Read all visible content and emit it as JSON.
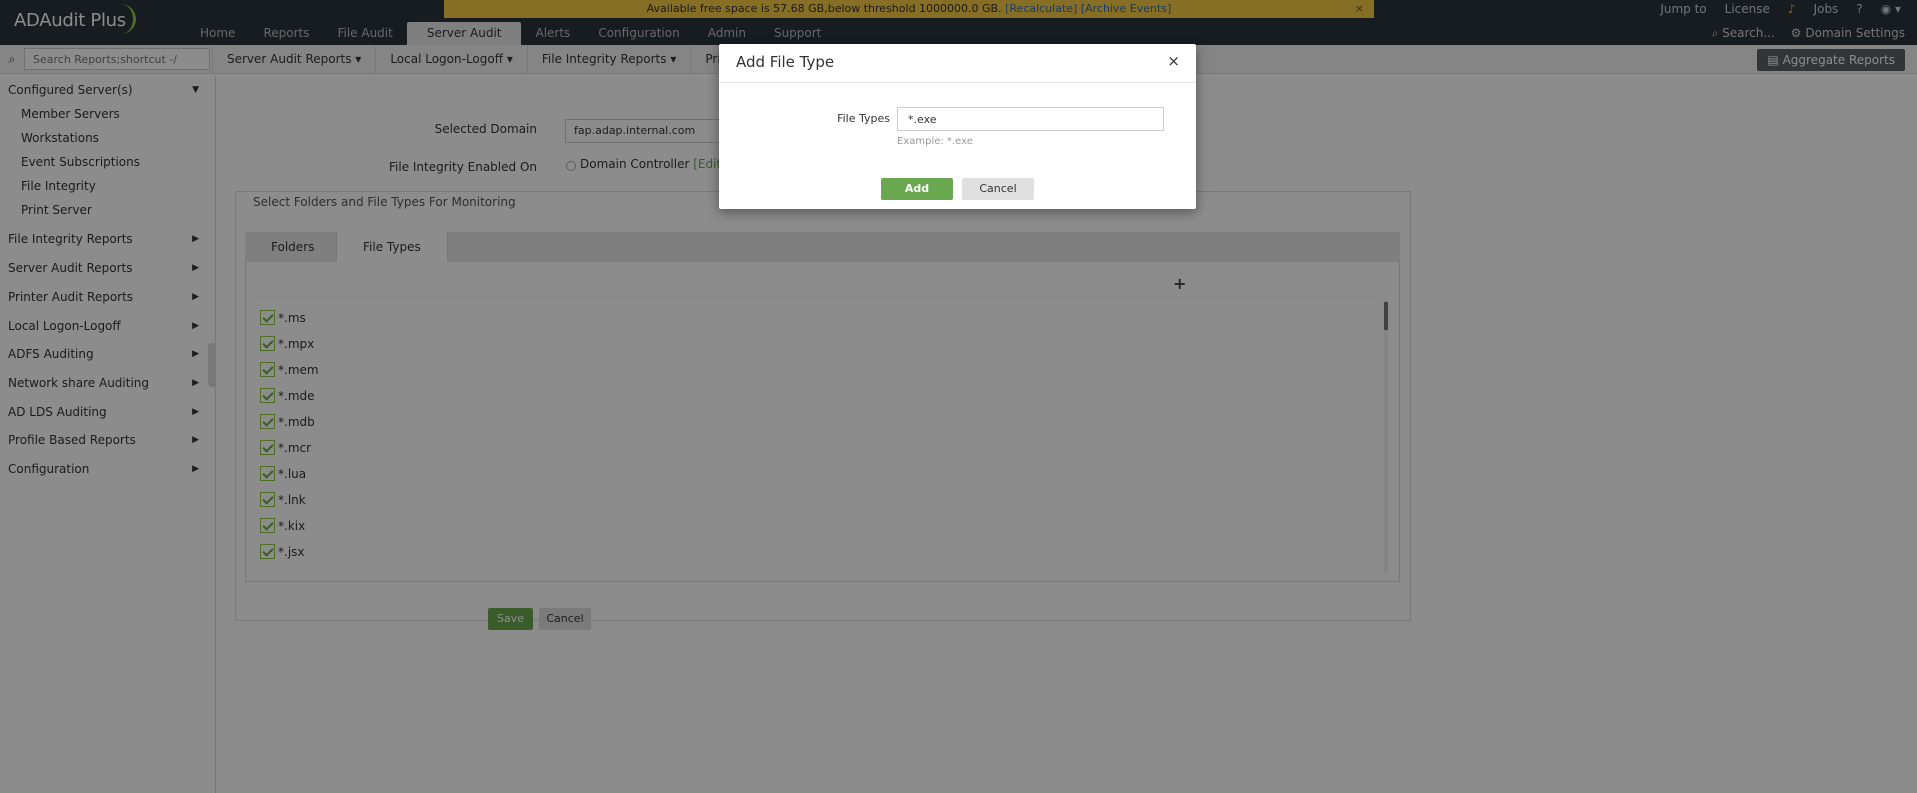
{
  "app": {
    "logo": "ADAudit Plus",
    "banner": {
      "text": "Available free space is 57.68 GB,below threshold 1000000.0 GB.",
      "recalculate": "[Recalculate]",
      "archive": "[Archive Events]",
      "close": "×"
    },
    "main_tabs": [
      "Home",
      "Reports",
      "File Audit",
      "Server Audit",
      "Alerts",
      "Configuration",
      "Admin",
      "Support"
    ],
    "active_tab": "Server Audit",
    "top_right": {
      "jump_to": "Jump to",
      "license": "License",
      "jobs": "Jobs",
      "help": "?",
      "search": "Search...",
      "domain_settings": "Domain Settings"
    }
  },
  "subbar": {
    "search_placeholder": "Search Reports;shortcut -/",
    "menus": [
      "Server Audit Reports ▾",
      "Local Logon-Logoff ▾",
      "File Integrity Reports ▾",
      "Printer Audit R"
    ],
    "aggregate": "Aggregate Reports"
  },
  "sidebar": {
    "configured": "Configured Server(s)",
    "sub_items": [
      "Member Servers",
      "Workstations",
      "Event Subscriptions",
      "File Integrity",
      "Print Server"
    ],
    "sections": [
      "File Integrity Reports",
      "Server Audit Reports",
      "Printer Audit Reports",
      "Local Logon-Logoff",
      "ADFS Auditing",
      "Network share Auditing",
      "AD LDS Auditing",
      "Profile Based Reports",
      "Configuration"
    ]
  },
  "form": {
    "selected_domain_label": "Selected Domain",
    "selected_domain_value": "fap.adap.internal.com",
    "fi_enabled_label": "File Integrity Enabled On",
    "fi_enabled_value": "Domain Controller",
    "edit": "[Edit]",
    "section_title": "Select Folders and File Types For Monitoring",
    "tabs": [
      "Folders",
      "File Types"
    ],
    "active_tab": "File Types",
    "add_icon": "+",
    "file_types": [
      "*.ms",
      "*.mpx",
      "*.mem",
      "*.mde",
      "*.mdb",
      "*.mcr",
      "*.lua",
      "*.lnk",
      "*.kix",
      "*.jsx"
    ],
    "save": "Save",
    "cancel": "Cancel"
  },
  "modal": {
    "title": "Add File Type",
    "close": "×",
    "field_label": "File Types",
    "field_value": "*.exe",
    "hint": "Example: *.exe",
    "add": "Add",
    "cancel": "Cancel"
  },
  "colors": {
    "header_bg": "#2b333b",
    "banner_bg": "#f5c842",
    "accent_green": "#6aa84f",
    "overlay": "rgba(0,0,0,0.45)"
  }
}
